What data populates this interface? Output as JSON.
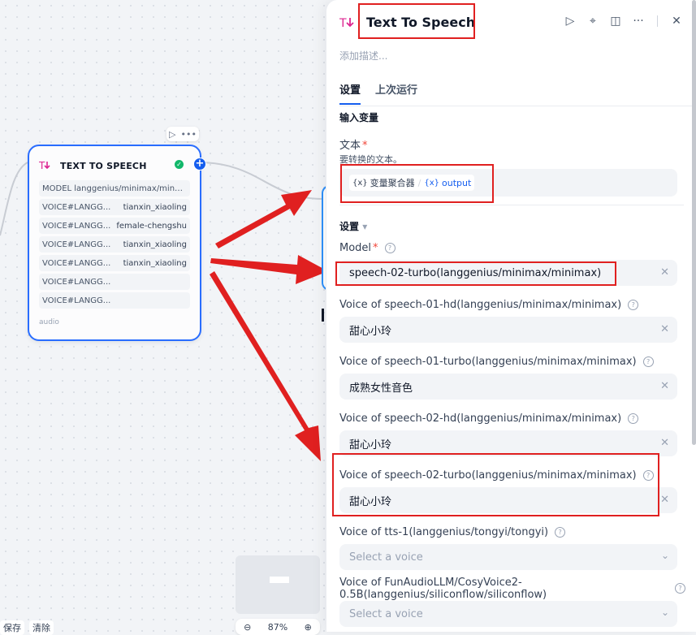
{
  "canvas": {
    "node": {
      "title": "TEXT TO SPEECH",
      "rows": [
        {
          "key": "MODEL langgenius/minimax/mini...",
          "value": ""
        },
        {
          "key": "VOICE#LANGG...",
          "value": "tianxin_xiaoling"
        },
        {
          "key": "VOICE#LANGG...",
          "value": "female-chengshu"
        },
        {
          "key": "VOICE#LANGG...",
          "value": "tianxin_xiaoling"
        },
        {
          "key": "VOICE#LANGG...",
          "value": "tianxin_xiaoling"
        },
        {
          "key": "VOICE#LANGG...",
          "value": ""
        },
        {
          "key": "VOICE#LANGG...",
          "value": ""
        }
      ],
      "footer": "audio",
      "toolbar_run": "▷",
      "toolbar_more": "•••"
    },
    "bottom_left": {
      "save": "保存",
      "clear": "清除"
    },
    "zoom": {
      "out": "⊖",
      "level": "87%",
      "in": "⊕"
    }
  },
  "panel": {
    "title": "Text To Speech",
    "description_placeholder": "添加描述...",
    "actions": {
      "run": "▷",
      "locate": "⌖",
      "layout": "◫",
      "more": "···",
      "close": "✕"
    },
    "tabs": [
      {
        "label": "设置",
        "active": true
      },
      {
        "label": "上次运行",
        "active": false
      }
    ],
    "input_section": {
      "title": "输入变量",
      "text_label": "文本",
      "text_hint": "要转换的文本。",
      "var_source_icon": "{x}",
      "var_source": "变量聚合器",
      "var_name_icon": "{x}",
      "var_name": "output"
    },
    "settings": {
      "title": "设置",
      "caret": "▾",
      "model_label": "Model",
      "model_value": "speech-02-turbo(langgenius/minimax/minimax)",
      "voices": [
        {
          "label": "Voice of speech-01-hd(langgenius/minimax/minimax)",
          "value": "甜心小玲",
          "placeholder": false
        },
        {
          "label": "Voice of speech-01-turbo(langgenius/minimax/minimax)",
          "value": "成熟女性音色",
          "placeholder": false
        },
        {
          "label": "Voice of speech-02-hd(langgenius/minimax/minimax)",
          "value": "甜心小玲",
          "placeholder": false
        },
        {
          "label": "Voice of speech-02-turbo(langgenius/minimax/minimax)",
          "value": "甜心小玲",
          "placeholder": false
        },
        {
          "label": "Voice of tts-1(langgenius/tongyi/tongyi)",
          "value": "Select a voice",
          "placeholder": true
        },
        {
          "label": "Voice of FunAudioLLM/CosyVoice2-0.5B(langgenius/siliconflow/siliconflow)",
          "value": "Select a voice",
          "placeholder": true
        }
      ]
    }
  },
  "colors": {
    "accent": "#155eef",
    "annotation": "#e02020",
    "success": "#12b76a"
  }
}
